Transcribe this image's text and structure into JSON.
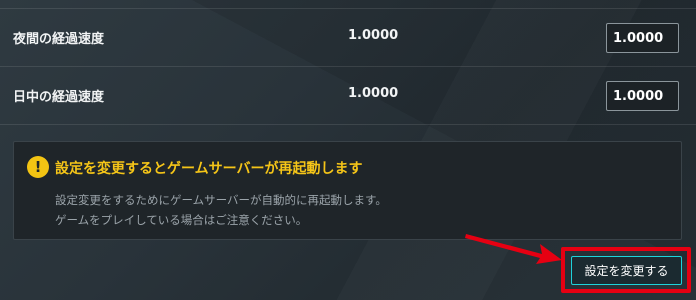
{
  "settings": [
    {
      "label": "夜間の経過速度",
      "current_value": "1.0000",
      "input_value": "1.0000"
    },
    {
      "label": "日中の経過速度",
      "current_value": "1.0000",
      "input_value": "1.0000"
    }
  ],
  "notice": {
    "icon": "!",
    "title": "設定を変更するとゲームサーバーが再起動します",
    "body_lines": [
      "設定変更をするためにゲームサーバーが自動的に再起動します。",
      "ゲームをプレイしている場合はご注意ください。"
    ]
  },
  "actions": {
    "change_button_label": "設定を変更する"
  },
  "colors": {
    "warning": "#f5c518",
    "accent_border": "#1ed2da",
    "highlight": "#e60012"
  }
}
